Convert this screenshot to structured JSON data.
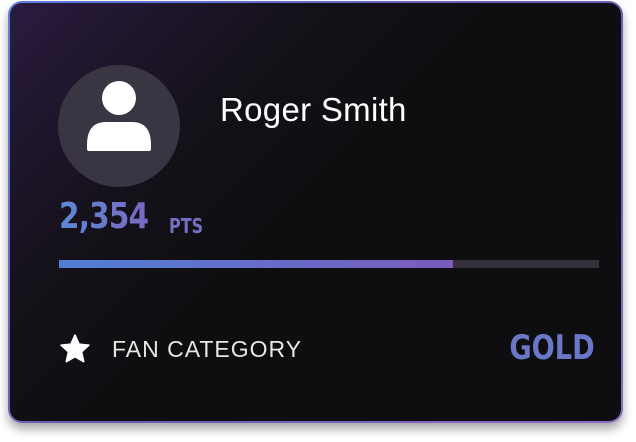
{
  "user": {
    "name": "Roger Smith",
    "avatar_icon": "user-silhouette-icon"
  },
  "points": {
    "value": "2,354",
    "unit": "PTS",
    "progress_fraction": 0.73
  },
  "fan_category": {
    "icon": "star-icon",
    "label": "FAN CATEGORY",
    "tier": "GOLD"
  },
  "colors": {
    "accent_blue": "#5b8ad8",
    "accent_purple": "#7a5bbd",
    "card_background": "#0e0e10",
    "track": "#332f3b"
  }
}
